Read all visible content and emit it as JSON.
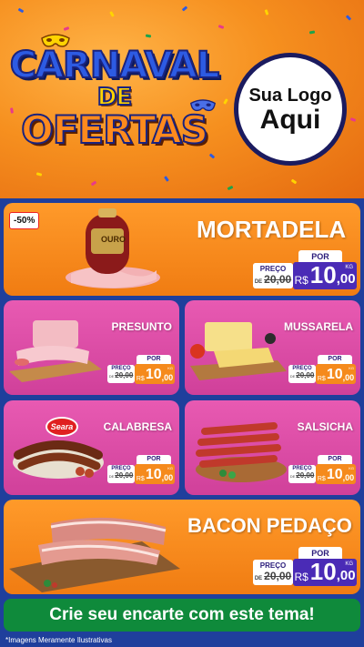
{
  "header": {
    "title_line1": "CARNAVAL",
    "title_line2": "DE",
    "title_line3": "OFERTAS",
    "logo_line1": "Sua Logo",
    "logo_line2": "Aqui"
  },
  "badge": "-50%",
  "products": [
    {
      "name": "MORTADELA",
      "por": "POR",
      "preco_label": "PREÇO",
      "old_prefix": "DE",
      "old_price": "20,00",
      "currency": "R$",
      "new_int": "10",
      "new_dec": ",00",
      "unit": "KG"
    },
    {
      "name": "PRESUNTO",
      "por": "POR",
      "preco_label": "PREÇO",
      "old_prefix": "DE",
      "old_price": "20,00",
      "currency": "R$",
      "new_int": "10",
      "new_dec": ",00",
      "unit": "KG"
    },
    {
      "name": "MUSSARELA",
      "por": "POR",
      "preco_label": "PREÇO",
      "old_prefix": "DE",
      "old_price": "20,00",
      "currency": "R$",
      "new_int": "10",
      "new_dec": ",00",
      "unit": "KG"
    },
    {
      "name": "CALABRESA",
      "por": "POR",
      "preco_label": "PREÇO",
      "old_prefix": "DE",
      "old_price": "20,00",
      "currency": "R$",
      "new_int": "10",
      "new_dec": ",00",
      "unit": "KG"
    },
    {
      "name": "SALSICHA",
      "por": "POR",
      "preco_label": "PREÇO",
      "old_prefix": "DE",
      "old_price": "20,00",
      "currency": "R$",
      "new_int": "10",
      "new_dec": ",00",
      "unit": "KG"
    },
    {
      "name": "BACON PEDAÇO",
      "por": "POR",
      "preco_label": "PREÇO",
      "old_prefix": "DE",
      "old_price": "20,00",
      "currency": "R$",
      "new_int": "10",
      "new_dec": ",00",
      "unit": "KG"
    }
  ],
  "brand_labels": {
    "mortadela": "OURO",
    "calabresa": "Seara"
  },
  "footer": {
    "cta": "Crie seu encarte com este tema!",
    "disclaimer": "*Imagens Meramente Ilustrativas"
  },
  "colors": {
    "orange": "#f07c12",
    "pink": "#d0409a",
    "purple": "#4a2bb6",
    "background_blue": "#1f3f9c",
    "footer_green": "#0f8a3b"
  }
}
